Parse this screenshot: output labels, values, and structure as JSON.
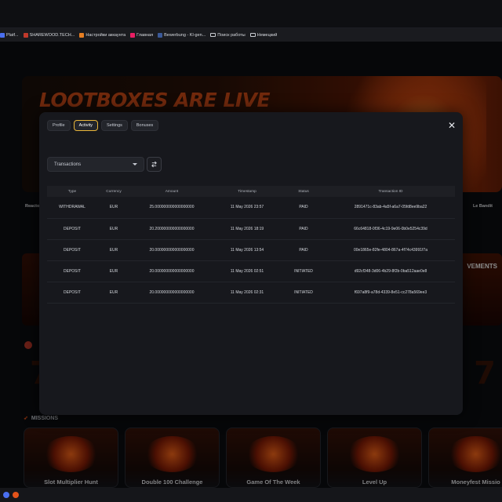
{
  "bookmarks": [
    {
      "label": "Platf...",
      "icon": "page-icon",
      "color": "#4a6ff0"
    },
    {
      "label": "SHAREWOOD.TECH...",
      "icon": "page-icon",
      "color": "#c0392b"
    },
    {
      "label": "Настройки аккаунта",
      "icon": "page-icon",
      "color": "#e67e22"
    },
    {
      "label": "Главная",
      "icon": "page-icon",
      "color": "#e91e63"
    },
    {
      "label": "Bewerbung - Kl-gen...",
      "icon": "page-icon",
      "color": "#3b5998"
    },
    {
      "label": "Поиск работы",
      "icon": "folder-icon",
      "color": ""
    },
    {
      "label": "Немецкий",
      "icon": "folder-icon",
      "color": ""
    }
  ],
  "background": {
    "hero_title": "LOOTBOXES ARE LIVE",
    "row_left_label": "Reacto",
    "row_right_label": "Le Bandit",
    "promo_right_text": "VEMENTS",
    "missions_label": "MISSIONS",
    "missions": [
      "Slot Multiplier Hunt",
      "Double 100 Challenge",
      "Game Of The Week",
      "Level Up",
      "Moneyfest Missio"
    ]
  },
  "modal": {
    "tabs": [
      "Profile",
      "Activity",
      "Settings",
      "Bonuses"
    ],
    "active_tab": "Activity",
    "close_icon": "close-icon",
    "filter": {
      "selected": "Transactions"
    },
    "table": {
      "headers": [
        "Type",
        "Currency",
        "Amount",
        "Timestamp",
        "Status",
        "Transaction ID"
      ],
      "rows": [
        [
          "WITHDRAWAL",
          "EUR",
          "25.000000000000000000",
          "11 May 2026 23:57",
          "PAID",
          "2891471c-83ab-4a5f-a6a7-05fd8ee9ba22"
        ],
        [
          "DEPOSIT",
          "EUR",
          "20.200000000000000000",
          "11 May 2026 18:19",
          "PAID",
          "66c64818-0f36-4c19-9e06-0b0e5254c39d"
        ],
        [
          "DEPOSIT",
          "EUR",
          "20.000000000000000000",
          "11 May 2026 13:54",
          "PAID",
          "00e1865e-82fe-4804-867a-4f74c43991f7a"
        ],
        [
          "DEPOSIT",
          "EUR",
          "20.000000000000000000",
          "11 May 2026 02:51",
          "INITIATED",
          "d92cf348-3d06-4b29-8f2b-0ba512aae0e8"
        ],
        [
          "DEPOSIT",
          "EUR",
          "20.000000000000000000",
          "11 May 2026 02:31",
          "INITIATED",
          "f697a8f9-a78d-4339-8e51-cc278a569ee3"
        ]
      ]
    }
  },
  "colors": {
    "accent": "#e8b53a",
    "modal_bg": "#17181d",
    "brand_orange": "#e2531a"
  }
}
